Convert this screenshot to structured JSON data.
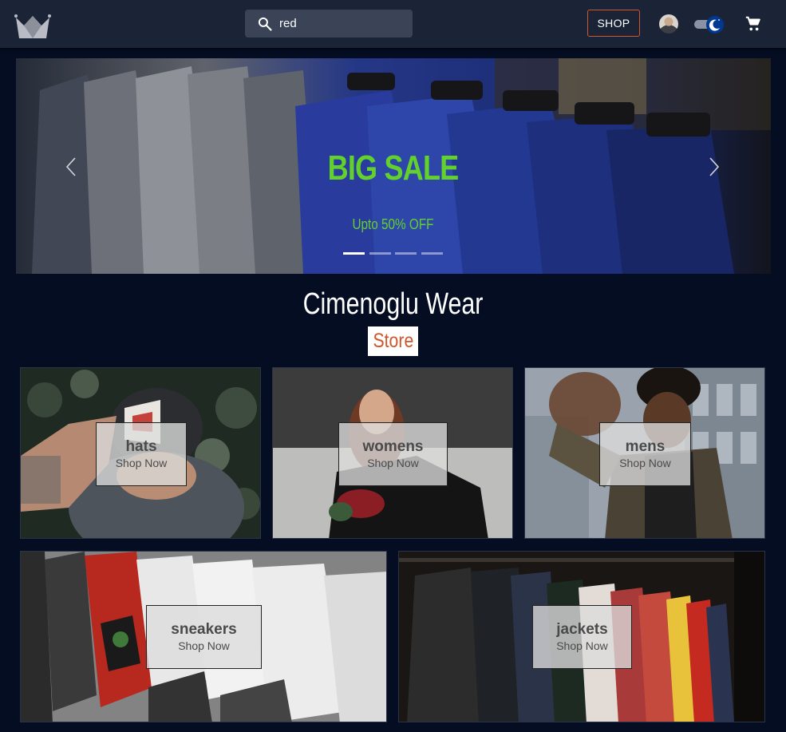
{
  "header": {
    "search": {
      "value": "red",
      "placeholder": ""
    },
    "shop_label": "SHOP"
  },
  "hero": {
    "title": "BIG SALE",
    "subtitle": "Upto 50% OFF",
    "slide_count": 4,
    "active_slide": 1
  },
  "brand": {
    "name": "Cimenoglu Wear",
    "badge": "Store"
  },
  "categories": [
    {
      "name": "hats",
      "cta": "Shop Now"
    },
    {
      "name": "womens",
      "cta": "Shop Now"
    },
    {
      "name": "mens",
      "cta": "Shop Now"
    },
    {
      "name": "sneakers",
      "cta": "Shop Now"
    },
    {
      "name": "jackets",
      "cta": "Shop Now"
    }
  ],
  "colors": {
    "background": "#040d22",
    "header": "#1a2436",
    "accent_orange": "#d0552a",
    "sale_green": "#62d12b"
  },
  "icons": {
    "logo": "crown-logo",
    "search": "search-icon",
    "cart": "shopping-cart-icon",
    "theme_toggle": "dark-mode-toggle",
    "prev": "chevron-left-icon",
    "next": "chevron-right-icon"
  }
}
